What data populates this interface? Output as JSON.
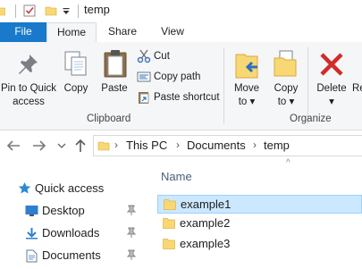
{
  "window": {
    "title": "temp"
  },
  "tabs": [
    {
      "label": "File"
    },
    {
      "label": "Home"
    },
    {
      "label": "Share"
    },
    {
      "label": "View"
    }
  ],
  "ribbon": {
    "clipboard": {
      "pin_label_line1": "Pin to Quick",
      "pin_label_line2": "access",
      "copy_label": "Copy",
      "paste_label": "Paste",
      "cut_label": "Cut",
      "copy_path_label": "Copy path",
      "paste_shortcut_label": "Paste shortcut",
      "group_label": "Clipboard"
    },
    "organize": {
      "move_to_line1": "Move",
      "move_to_line2": "to",
      "copy_to_line1": "Copy",
      "copy_to_line2": "to",
      "delete_label": "Delete",
      "rename_partial": "Re",
      "group_label": "Organize"
    }
  },
  "address": {
    "crumbs": [
      "This PC",
      "Documents",
      "temp"
    ]
  },
  "nav_pane": {
    "items": [
      {
        "label": "Quick access",
        "icon": "star-icon"
      },
      {
        "label": "Desktop",
        "icon": "desktop-folder-icon",
        "pinned": true
      },
      {
        "label": "Downloads",
        "icon": "downloads-folder-icon",
        "pinned": true
      },
      {
        "label": "Documents",
        "icon": "documents-folder-icon",
        "pinned": true
      }
    ]
  },
  "file_list": {
    "column_name": "Name",
    "rows": [
      {
        "name": "example1",
        "selected": true
      },
      {
        "name": "example2",
        "selected": false
      },
      {
        "name": "example3",
        "selected": false
      }
    ]
  },
  "colors": {
    "accent": "#1979ca",
    "selection": "#cce8ff",
    "folder": "#f8d775",
    "delete_red": "#d32a2a"
  }
}
